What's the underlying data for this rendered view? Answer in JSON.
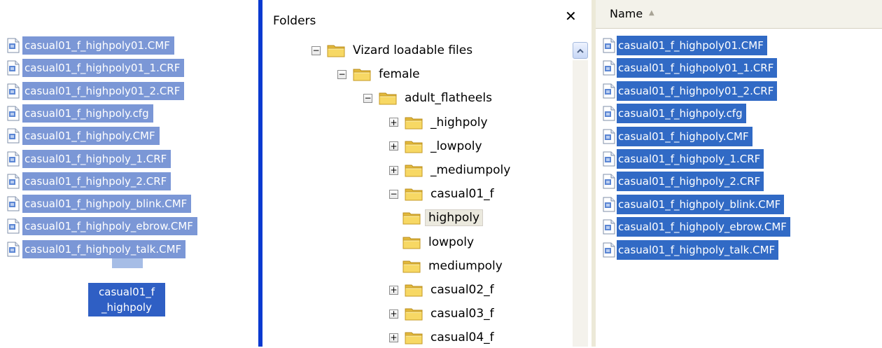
{
  "drag_ghost": {
    "files": [
      "casual01_f_highpoly01.CMF",
      "casual01_f_highpoly01_1.CRF",
      "casual01_f_highpoly01_2.CRF",
      "casual01_f_highpoly.cfg",
      "casual01_f_highpoly.CMF",
      "casual01_f_highpoly_1.CRF",
      "casual01_f_highpoly_2.CRF",
      "casual01_f_highpoly_blink.CMF",
      "casual01_f_highpoly_ebrow.CMF",
      "casual01_f_highpoly_talk.CMF"
    ],
    "caption_line1": "casual01_f",
    "caption_line2": "_highpoly"
  },
  "folders_pane": {
    "title": "Folders",
    "close_icon": "close-icon",
    "tree": [
      {
        "label": "Vizard loadable files",
        "expander": "minus"
      },
      {
        "label": "female",
        "expander": "minus"
      },
      {
        "label": "adult_flatheels",
        "expander": "minus"
      },
      {
        "label": "_highpoly",
        "expander": "plus"
      },
      {
        "label": "_lowpoly",
        "expander": "plus"
      },
      {
        "label": "_mediumpoly",
        "expander": "plus"
      },
      {
        "label": "casual01_f",
        "expander": "minus"
      },
      {
        "label": "highpoly",
        "expander": "none",
        "selected": true
      },
      {
        "label": "lowpoly",
        "expander": "none"
      },
      {
        "label": "mediumpoly",
        "expander": "none"
      },
      {
        "label": "casual02_f",
        "expander": "plus"
      },
      {
        "label": "casual03_f",
        "expander": "plus"
      },
      {
        "label": "casual04_f",
        "expander": "plus"
      }
    ]
  },
  "file_list": {
    "column_name": "Name",
    "sort_icon": "sort-ascending-icon",
    "files": [
      "casual01_f_highpoly01.CMF",
      "casual01_f_highpoly01_1.CRF",
      "casual01_f_highpoly01_2.CRF",
      "casual01_f_highpoly.cfg",
      "casual01_f_highpoly.CMF",
      "casual01_f_highpoly_1.CRF",
      "casual01_f_highpoly_2.CRF",
      "casual01_f_highpoly_blink.CMF",
      "casual01_f_highpoly_ebrow.CMF",
      "casual01_f_highpoly_talk.CMF"
    ]
  },
  "colors": {
    "selection": "#316ac5",
    "ghost_selection": "#7b97d6",
    "folder_yellow": "#f5cd4e",
    "pane_divider": "#0a3ad0"
  }
}
